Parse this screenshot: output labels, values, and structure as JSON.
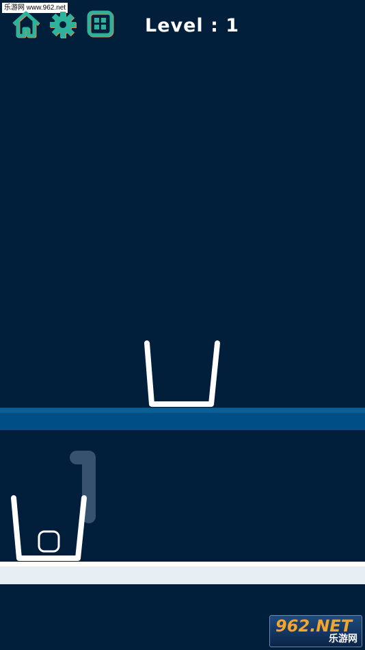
{
  "watermark_top": "乐游网 www.962.net",
  "hud": {
    "level_text": "Level : 1"
  },
  "icons": {
    "home": "home-icon",
    "settings": "gear-icon",
    "levels": "grid-icon"
  },
  "colors": {
    "background": "#011e3b",
    "upper_platform": "#004e86",
    "lower_platform": "#e7eff5",
    "icon_green": "#2db39b",
    "icon_orange": "#d9894a",
    "drawn_line_ghost": "#3d5875"
  },
  "watermark_bottom": {
    "main": "962.NET",
    "sub": "乐游网"
  }
}
